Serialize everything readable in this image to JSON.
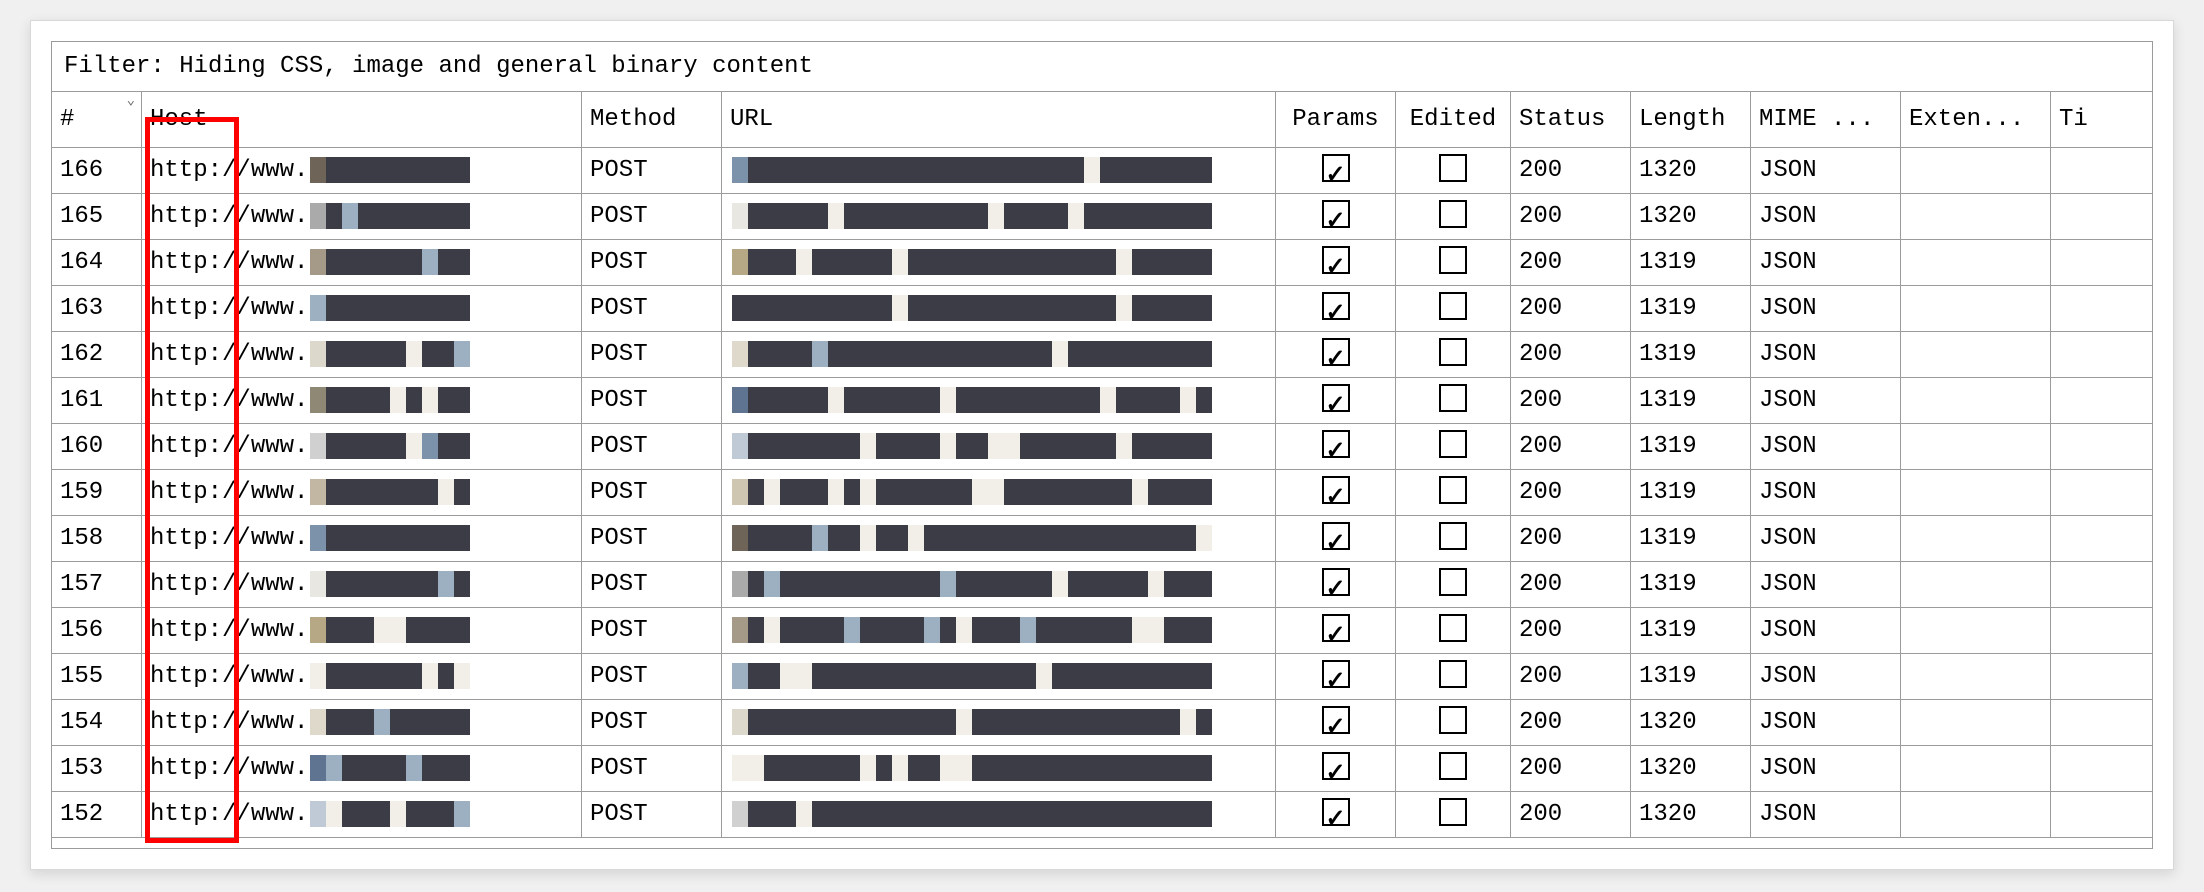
{
  "filter_text": "Filter: Hiding CSS, image and general binary content",
  "columns": {
    "num": "#",
    "host": "Host",
    "method": "Method",
    "url": "URL",
    "params": "Params",
    "edited": "Edited",
    "status": "Status",
    "length": "Length",
    "mime": "MIME ...",
    "ext": "Exten...",
    "title": "Ti"
  },
  "sort_indicator": "⌄",
  "host_prefix": "http://www.",
  "rows": [
    {
      "num": "166",
      "method": "POST",
      "params": true,
      "edited": false,
      "status": "200",
      "length": "1320",
      "mime": "JSON",
      "ext": "",
      "title": ""
    },
    {
      "num": "165",
      "method": "POST",
      "params": true,
      "edited": false,
      "status": "200",
      "length": "1320",
      "mime": "JSON",
      "ext": "",
      "title": ""
    },
    {
      "num": "164",
      "method": "POST",
      "params": true,
      "edited": false,
      "status": "200",
      "length": "1319",
      "mime": "JSON",
      "ext": "",
      "title": ""
    },
    {
      "num": "163",
      "method": "POST",
      "params": true,
      "edited": false,
      "status": "200",
      "length": "1319",
      "mime": "JSON",
      "ext": "",
      "title": ""
    },
    {
      "num": "162",
      "method": "POST",
      "params": true,
      "edited": false,
      "status": "200",
      "length": "1319",
      "mime": "JSON",
      "ext": "",
      "title": ""
    },
    {
      "num": "161",
      "method": "POST",
      "params": true,
      "edited": false,
      "status": "200",
      "length": "1319",
      "mime": "JSON",
      "ext": "",
      "title": ""
    },
    {
      "num": "160",
      "method": "POST",
      "params": true,
      "edited": false,
      "status": "200",
      "length": "1319",
      "mime": "JSON",
      "ext": "",
      "title": ""
    },
    {
      "num": "159",
      "method": "POST",
      "params": true,
      "edited": false,
      "status": "200",
      "length": "1319",
      "mime": "JSON",
      "ext": "",
      "title": ""
    },
    {
      "num": "158",
      "method": "POST",
      "params": true,
      "edited": false,
      "status": "200",
      "length": "1319",
      "mime": "JSON",
      "ext": "",
      "title": ""
    },
    {
      "num": "157",
      "method": "POST",
      "params": true,
      "edited": false,
      "status": "200",
      "length": "1319",
      "mime": "JSON",
      "ext": "",
      "title": ""
    },
    {
      "num": "156",
      "method": "POST",
      "params": true,
      "edited": false,
      "status": "200",
      "length": "1319",
      "mime": "JSON",
      "ext": "",
      "title": ""
    },
    {
      "num": "155",
      "method": "POST",
      "params": true,
      "edited": false,
      "status": "200",
      "length": "1319",
      "mime": "JSON",
      "ext": "",
      "title": ""
    },
    {
      "num": "154",
      "method": "POST",
      "params": true,
      "edited": false,
      "status": "200",
      "length": "1320",
      "mime": "JSON",
      "ext": "",
      "title": ""
    },
    {
      "num": "153",
      "method": "POST",
      "params": true,
      "edited": false,
      "status": "200",
      "length": "1320",
      "mime": "JSON",
      "ext": "",
      "title": ""
    },
    {
      "num": "152",
      "method": "POST",
      "params": true,
      "edited": false,
      "status": "200",
      "length": "1320",
      "mime": "JSON",
      "ext": "",
      "title": ""
    }
  ],
  "highlight": {
    "scheme_text": "http:"
  }
}
